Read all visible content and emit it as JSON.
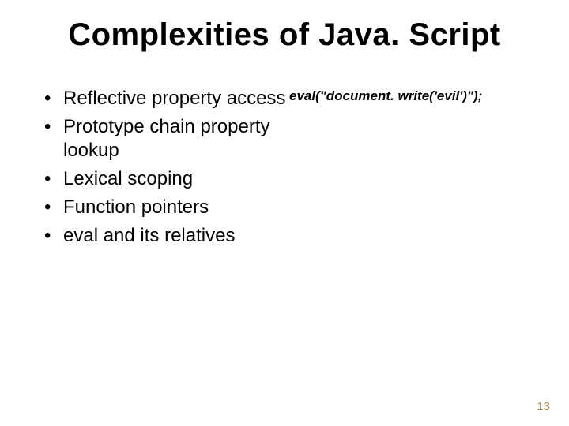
{
  "title": "Complexities of Java. Script",
  "bullets": [
    "Reflective property access",
    "Prototype chain property lookup",
    "Lexical scoping",
    "Function pointers",
    "eval and its relatives"
  ],
  "code_sample": "eval(\"document. write('evil')\");",
  "page_number": "13"
}
